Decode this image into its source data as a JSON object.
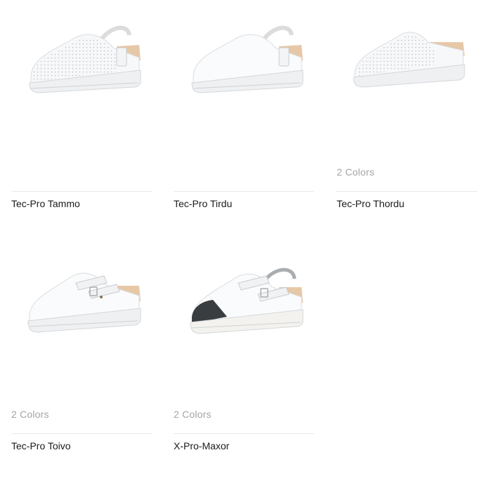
{
  "products": [
    {
      "name": "Tec-Pro Tammo",
      "colors": "",
      "image_icon": "perforated-clog-with-strap-image"
    },
    {
      "name": "Tec-Pro Tirdu",
      "colors": "",
      "image_icon": "smooth-clog-with-strap-image"
    },
    {
      "name": "Tec-Pro Thordu",
      "colors": "2 Colors",
      "image_icon": "perforated-clog-image"
    },
    {
      "name": "Tec-Pro Toivo",
      "colors": "2 Colors",
      "image_icon": "clog-with-buckle-image"
    },
    {
      "name": "X-Pro-Maxor",
      "colors": "2 Colors",
      "image_icon": "safety-clog-with-toe-cap-image"
    }
  ],
  "colors": {
    "text": "#1a1a1a",
    "muted": "#a5a5a5",
    "divider": "#e9e9e9",
    "toe_cap": "#3a3d40",
    "insole": "#e2c4a4"
  }
}
